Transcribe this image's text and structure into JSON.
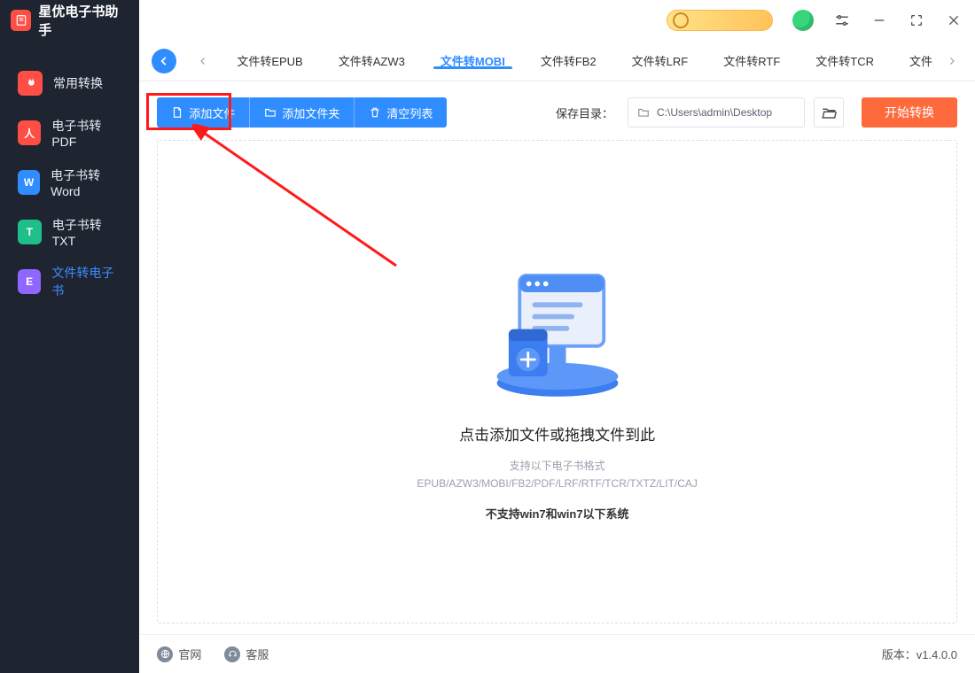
{
  "app": {
    "title": "星优电子书助手"
  },
  "sidebar": {
    "items": [
      {
        "label": "常用转换",
        "icon_text": "",
        "badge": "fire"
      },
      {
        "label": "电子书转PDF",
        "icon_text": "人"
      },
      {
        "label": "电子书转Word",
        "icon_text": "W"
      },
      {
        "label": "电子书转TXT",
        "icon_text": "T"
      },
      {
        "label": "文件转电子书",
        "icon_text": "E",
        "active": true
      }
    ]
  },
  "tabs": {
    "items": [
      {
        "label": "文件转EPUB"
      },
      {
        "label": "文件转AZW3"
      },
      {
        "label": "文件转MOBI",
        "active": true
      },
      {
        "label": "文件转FB2"
      },
      {
        "label": "文件转LRF"
      },
      {
        "label": "文件转RTF"
      },
      {
        "label": "文件转TCR"
      }
    ],
    "overflow": "文件"
  },
  "toolbar": {
    "add_file": "添加文件",
    "add_folder": "添加文件夹",
    "clear_list": "清空列表",
    "save_label": "保存目录：",
    "save_path": "C:\\Users\\admin\\Desktop",
    "start": "开始转换"
  },
  "drop": {
    "title": "点击添加文件或拖拽文件到此",
    "sub1": "支持以下电子书格式",
    "sub2": "EPUB/AZW3/MOBI/FB2/PDF/LRF/RTF/TCR/TXTZ/LIT/CAJ",
    "warn": "不支持win7和win7以下系统"
  },
  "footer": {
    "site": "官网",
    "support": "客服",
    "version_label": "版本：",
    "version": "v1.4.0.0"
  }
}
